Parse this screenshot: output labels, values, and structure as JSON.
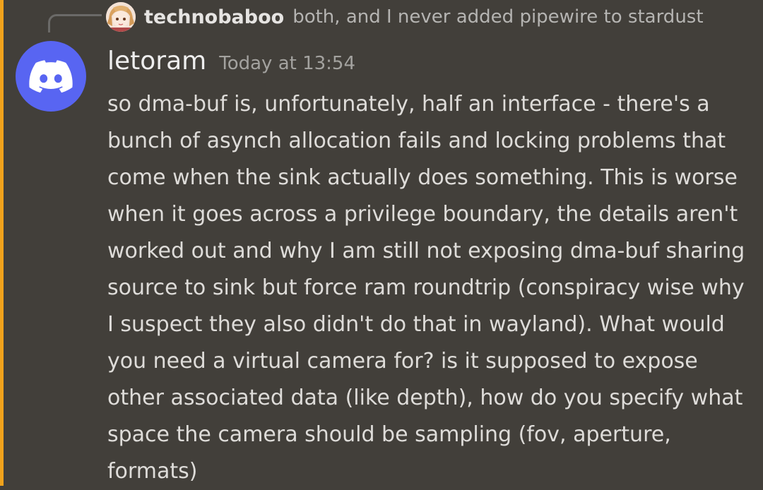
{
  "reply": {
    "author": "technobaboo",
    "text": "both, and I never added pipewire to stardust"
  },
  "message": {
    "author": "letoram",
    "timestamp": "Today at 13:54",
    "lines": [
      "so dma-buf is, unfortunately, half an interface - there's a",
      "bunch of asynch allocation fails and locking problems that",
      "come when the sink actually does something. This is worse",
      "when it goes across a privilege boundary, the details aren't",
      "worked out and why I am still not exposing dma-buf sharing",
      "source to sink but force ram roundtrip (conspiracy wise why",
      "I suspect they also didn't do that in wayland). What would",
      "you need a virtual camera for? is it supposed to expose",
      "other associated data (like depth), how do you specify what",
      "space the camera should be sampling (fov, aperture,",
      "formats)"
    ]
  },
  "colors": {
    "background": "#423f3a",
    "accent_bar": "#f0a21c",
    "avatar_blurple": "#5865f2"
  },
  "icons": {
    "avatar": "discord-logo-icon",
    "reply_avatar": "anime-avatar-image"
  }
}
